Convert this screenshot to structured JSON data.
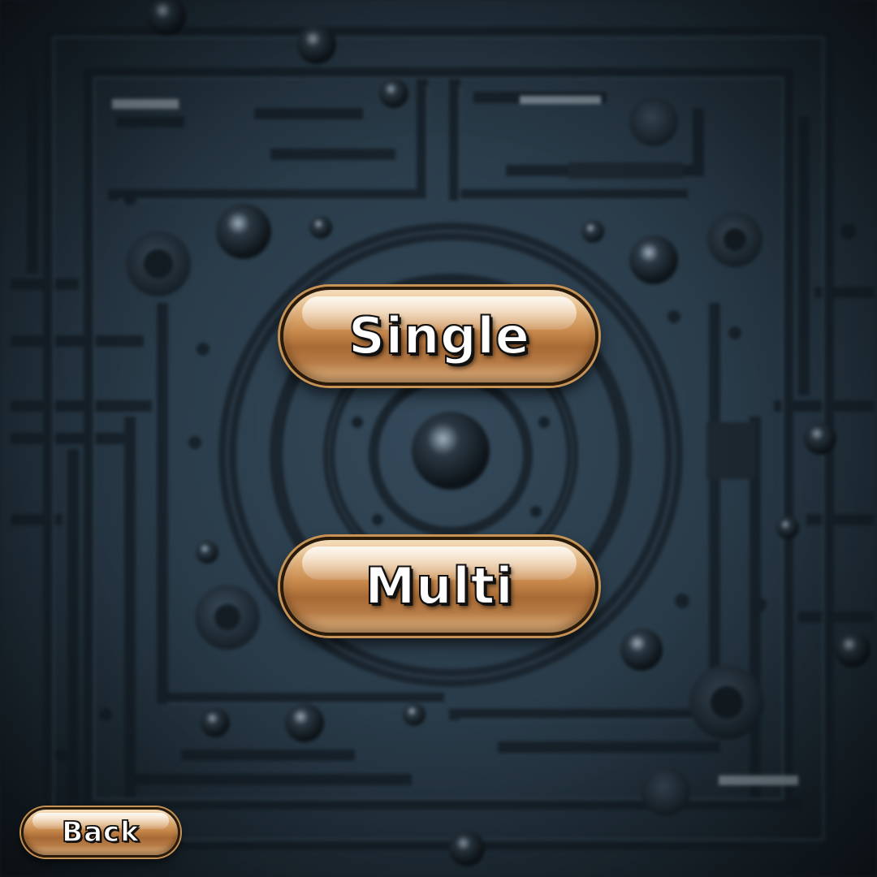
{
  "menu": {
    "single_label": "Single",
    "multi_label": "Multi",
    "back_label": "Back"
  },
  "theme": {
    "background_color": "#2a3a47",
    "button_color": "#c8894c",
    "button_text_color": "#ffffff"
  }
}
